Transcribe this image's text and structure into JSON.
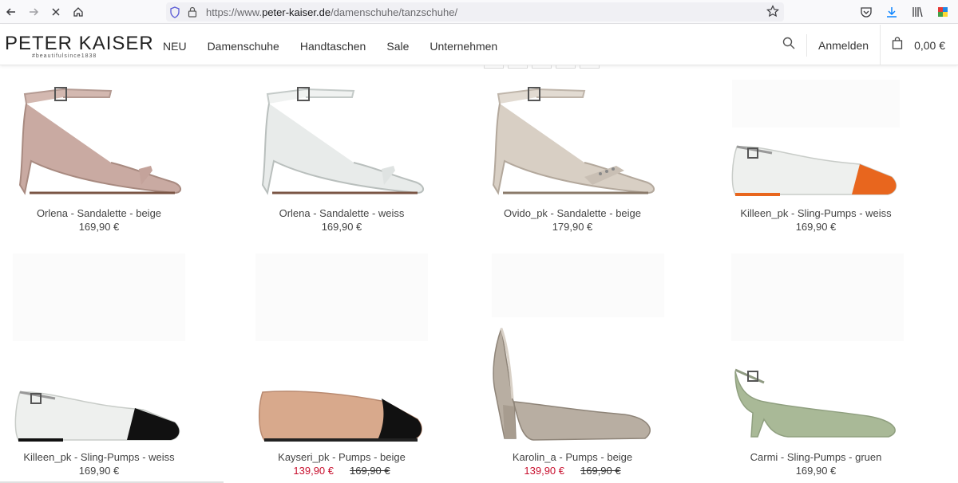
{
  "browser": {
    "url_prefix": "https://www.",
    "url_host": "peter-kaiser.de",
    "url_path": "/damenschuhe/tanzschuhe/"
  },
  "header": {
    "logo_main": "PETER KAISER",
    "logo_sub": "#beautifulsince1838",
    "nav": [
      "NEU",
      "Damenschuhe",
      "Handtaschen",
      "Sale",
      "Unternehmen"
    ],
    "login_label": "Anmelden",
    "cart_amount": "0,00 €"
  },
  "products": [
    {
      "name": "Orlena - Sandalette - beige",
      "price": "169,90 €",
      "color": "#c9aaa2",
      "style": "sandal"
    },
    {
      "name": "Orlena - Sandalette - weiss",
      "price": "169,90 €",
      "color": "#e8ebea",
      "style": "sandal"
    },
    {
      "name": "Ovido_pk - Sandalette - beige",
      "price": "179,90 €",
      "color": "#d8cfc4",
      "style": "sandal"
    },
    {
      "name": "Killeen_pk - Sling-Pumps - weiss",
      "price": "169,90 €",
      "color": "#eef0ee",
      "toe": "#e8661e",
      "style": "flat"
    },
    {
      "name": "Killeen_pk - Sling-Pumps - weiss",
      "price": "169,90 €",
      "color": "#eef0ee",
      "toe": "#111111",
      "style": "flat"
    },
    {
      "name": "Kayseri_pk - Pumps - beige",
      "sale_price": "139,90 €",
      "old_price": "169,90 €",
      "color": "#d8a98c",
      "toe": "#111111",
      "style": "ballet"
    },
    {
      "name": "Karolin_a - Pumps - beige",
      "sale_price": "139,90 €",
      "old_price": "169,90 €",
      "color": "#b8aea2",
      "style": "pump"
    },
    {
      "name": "Carmi - Sling-Pumps - gruen",
      "price": "169,90 €",
      "color": "#a9b997",
      "style": "slingheel"
    }
  ]
}
